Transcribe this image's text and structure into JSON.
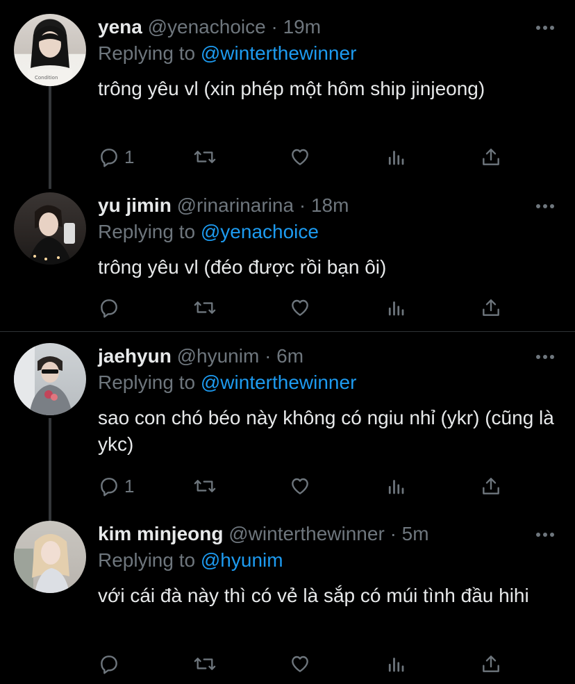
{
  "replies": [
    {
      "name": "yena",
      "handle": "@yenachoice",
      "time": "19m",
      "replying_prefix": "Replying to",
      "replying_to": "@winterthewinner",
      "text": "trông yêu vl (xin phép một hôm ship jinjeong)",
      "reply_count": "1"
    },
    {
      "name": "yu jimin",
      "handle": "@rinarinarina",
      "time": "18m",
      "replying_prefix": "Replying to",
      "replying_to": "@yenachoice",
      "text": "trông yêu vl (đéo được rồi bạn ôi)",
      "reply_count": ""
    },
    {
      "name": "jaehyun",
      "handle": "@hyunim",
      "time": "6m",
      "replying_prefix": "Replying to",
      "replying_to": "@winterthewinner",
      "text": "sao con chó béo này không có ngiu nhỉ (ykr) (cũng là ykc)",
      "reply_count": "1"
    },
    {
      "name": "kim minjeong",
      "handle": "@winterthewinner",
      "time": "5m",
      "replying_prefix": "Replying to",
      "replying_to": "@hyunim",
      "text": "với cái đà này thì có vẻ là sắp có múi tình đầu hihi",
      "reply_count": ""
    }
  ],
  "separator": "·",
  "colors": {
    "background": "#000000",
    "text": "#e7e9ea",
    "muted": "#6e767d",
    "mention": "#1d9bf0"
  },
  "icons": [
    "reply-icon",
    "retweet-icon",
    "like-icon",
    "analytics-icon",
    "share-icon",
    "more-icon"
  ]
}
